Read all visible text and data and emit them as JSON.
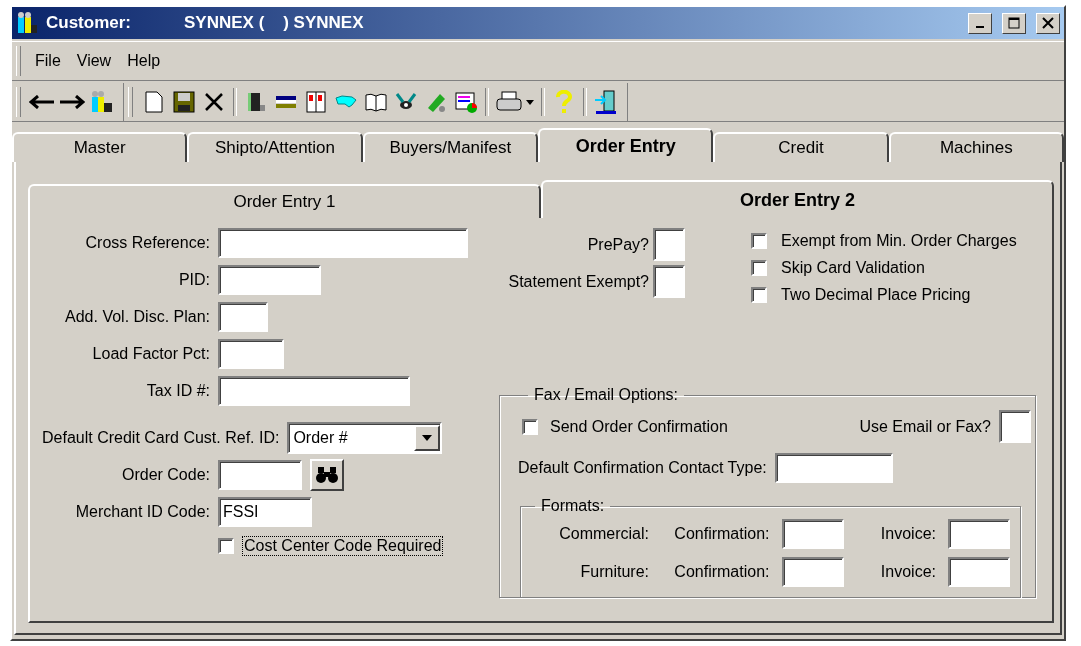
{
  "window": {
    "title": "Customer:",
    "subtitle": "SYNNEX (    ) SYNNEX"
  },
  "menu": [
    {
      "label": "File"
    },
    {
      "label": "View"
    },
    {
      "label": "Help"
    }
  ],
  "tabs": [
    {
      "label": "Master",
      "selected": false
    },
    {
      "label": "Shipto/Attention",
      "selected": false
    },
    {
      "label": "Buyers/Manifest",
      "selected": false
    },
    {
      "label": "Order Entry",
      "selected": true
    },
    {
      "label": "Credit",
      "selected": false
    },
    {
      "label": "Machines",
      "selected": false
    }
  ],
  "subtabs": [
    {
      "label": "Order Entry 1",
      "selected": false
    },
    {
      "label": "Order Entry 2",
      "selected": true
    }
  ],
  "left_fields": [
    {
      "kind": "text",
      "label": "Cross Reference:"
    },
    {
      "kind": "text",
      "label": "PID:"
    },
    {
      "kind": "text",
      "label": "Add. Vol. Disc. Plan:"
    },
    {
      "kind": "text",
      "label": "Load Factor Pct:"
    },
    {
      "kind": "text",
      "label": "Tax ID #:"
    },
    {
      "kind": "select",
      "label": "Default Credit Card Cust. Ref. ID:",
      "value": "Order #"
    },
    {
      "kind": "lookup",
      "label": "Order Code:"
    },
    {
      "kind": "text",
      "label": "Merchant ID Code:",
      "value": "FSSI"
    },
    {
      "kind": "checkbox",
      "label": "Cost Center Code Required",
      "checked": false,
      "focused": true
    }
  ],
  "flags": [
    {
      "label": "PrePay?"
    },
    {
      "label": "Statement Exempt?"
    }
  ],
  "options": [
    {
      "label": "Exempt from Min. Order Charges",
      "checked": false
    },
    {
      "label": "Skip Card Validation",
      "checked": false
    },
    {
      "label": "Two Decimal Place Pricing",
      "checked": false
    }
  ],
  "fax_email": {
    "title": "Fax / Email Options:",
    "send_confirmation": {
      "label": "Send Order Confirmation",
      "checked": false
    },
    "use_email_or_fax": {
      "label": "Use Email or Fax?"
    },
    "contact_type": {
      "label": "Default Confirmation Contact Type:"
    },
    "formats": {
      "title": "Formats:",
      "rows": [
        {
          "label": "Commercial:",
          "confirmation": "Confirmation:",
          "invoice": "Invoice:"
        },
        {
          "label": "Furniture:",
          "confirmation": "Confirmation:",
          "invoice": "Invoice:"
        }
      ]
    }
  }
}
